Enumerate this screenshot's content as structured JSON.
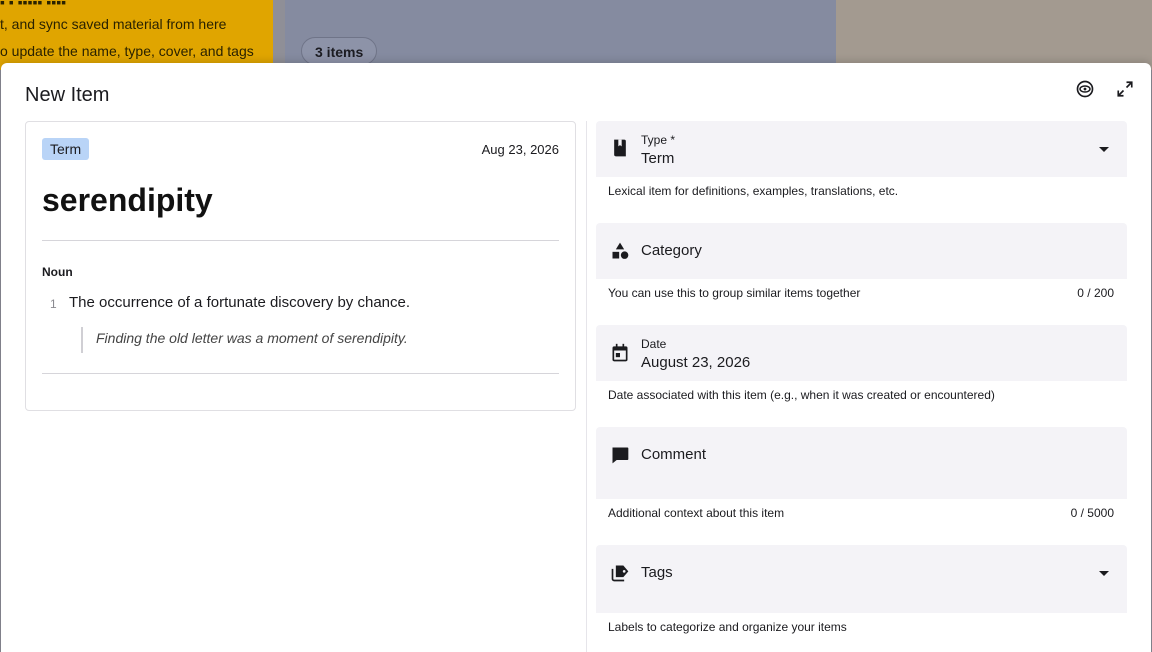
{
  "background": {
    "lines": [
      "t, and sync saved material from here",
      "o update the name, type, cover, and tags"
    ],
    "items_chip": "3 items"
  },
  "dialog": {
    "title": "New Item",
    "preview_icon": "eye-icon",
    "fullscreen_icon": "expand-icon"
  },
  "preview": {
    "type_badge": "Term",
    "date": "Aug 23, 2026",
    "word": "serendipity",
    "part_of_speech": "Noun",
    "sense_number": "1",
    "definition": "The occurrence of a fortunate discovery by chance.",
    "example": "Finding the old letter was a moment of serendipity."
  },
  "form": {
    "type": {
      "label": "Type *",
      "value": "Term",
      "helper": "Lexical item for definitions, examples, translations, etc.",
      "icon": "book-icon"
    },
    "category": {
      "label": "Category",
      "helper": "You can use this to group similar items together",
      "counter": "0 / 200",
      "icon": "shapes-icon"
    },
    "date": {
      "label": "Date",
      "value": "August 23, 2026",
      "helper": "Date associated with this item (e.g., when it was created or encountered)",
      "icon": "calendar-icon"
    },
    "comment": {
      "label": "Comment",
      "helper": "Additional context about this item",
      "counter": "0 / 5000",
      "icon": "comment-icon"
    },
    "tags": {
      "label": "Tags",
      "helper": "Labels to categorize and organize your items",
      "icon": "tags-icon"
    }
  }
}
